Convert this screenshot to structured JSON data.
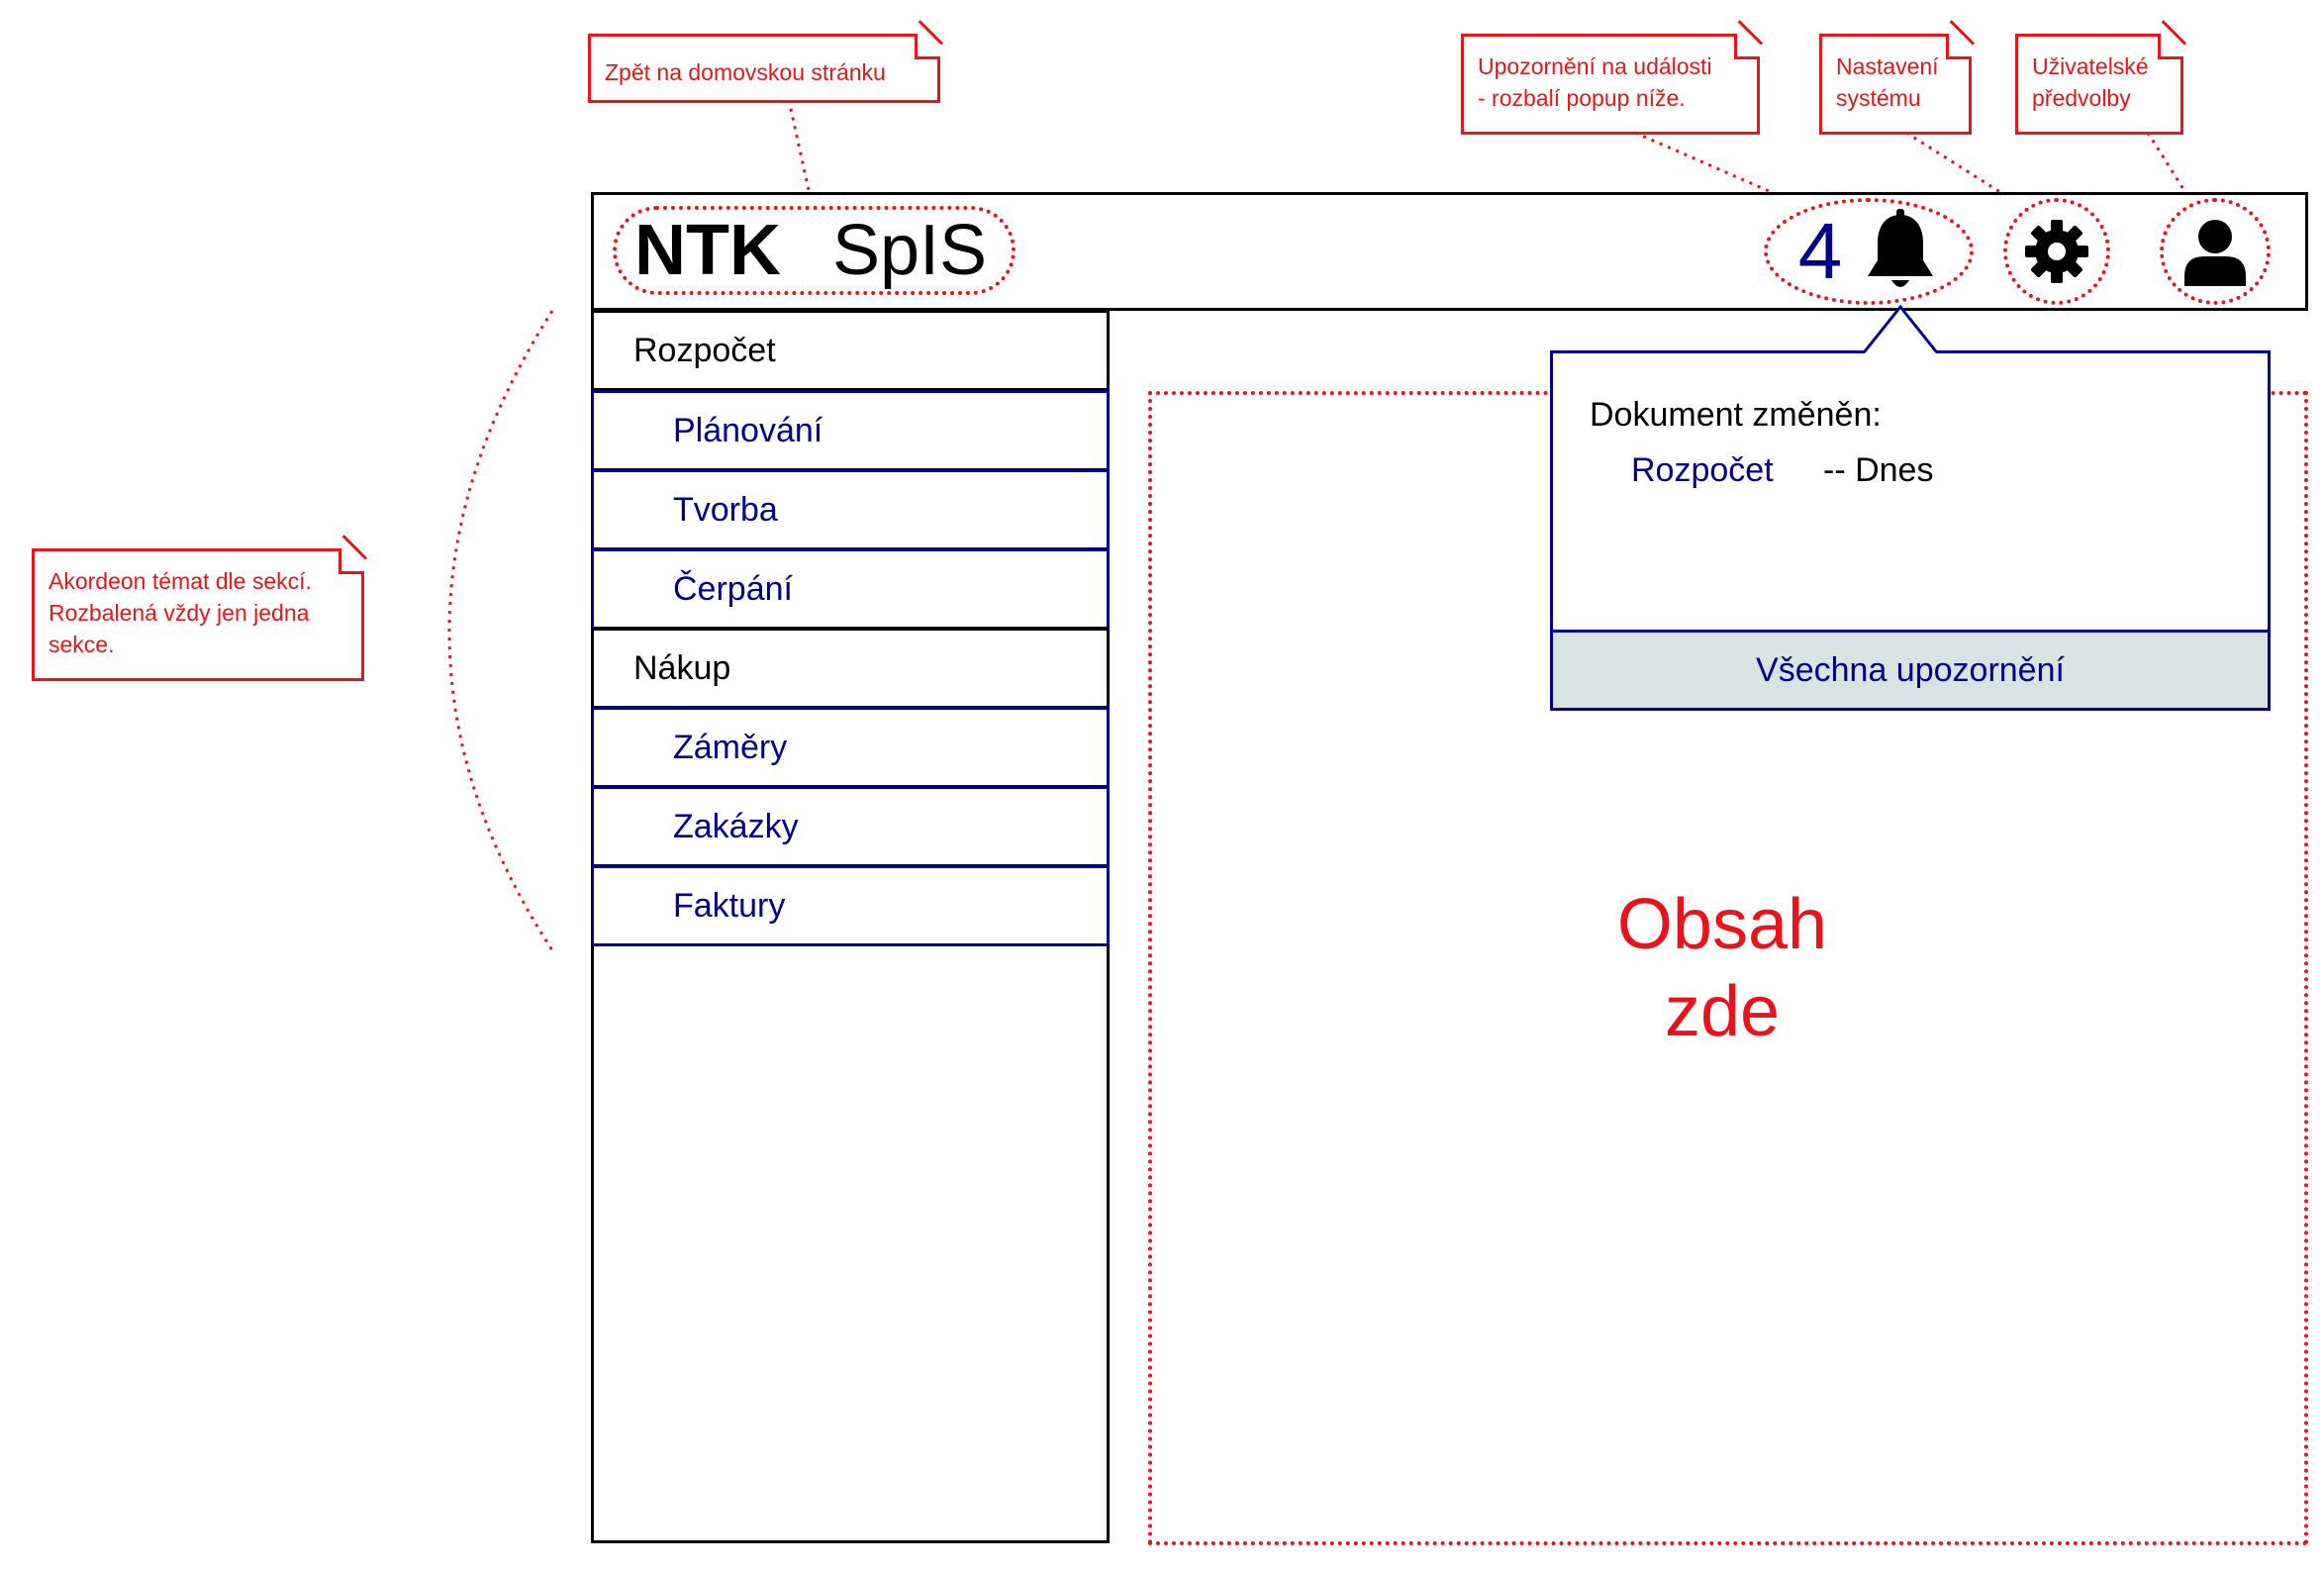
{
  "header": {
    "brand_strong": "NTK",
    "brand_light": "SpIS",
    "notification_count": "4",
    "icons": {
      "notifications": "bell-icon",
      "settings": "gear-icon",
      "profile": "user-icon"
    }
  },
  "sidebar": {
    "sections": [
      {
        "label": "Rozpočet",
        "items": [
          "Plánování",
          "Tvorba",
          "Čerpání"
        ]
      },
      {
        "label": "Nákup",
        "items": [
          "Záměry",
          "Zakázky",
          "Faktury"
        ]
      }
    ]
  },
  "popup": {
    "title": "Dokument změněn:",
    "entry_link": "Rozpočet",
    "entry_time": "-- Dnes",
    "footer": "Všechna upozornění"
  },
  "content": {
    "line1": "Obsah",
    "line2": "zde"
  },
  "annotations": {
    "home": "Zpět na domovskou stránku",
    "notifications": [
      "Upozornění na události",
      "- rozbalí popup níže."
    ],
    "settings": [
      "Nastavení",
      "systému"
    ],
    "profile": [
      "Uživatelské",
      "předvolby"
    ],
    "accordion": [
      "Akordeon témat dle sekcí.",
      "Rozbalená vždy jen jedna",
      "sekce."
    ]
  },
  "colors": {
    "accent": "#00008b",
    "annotation": "#e8141a",
    "popup_footer_bg": "#d8e4e4"
  }
}
